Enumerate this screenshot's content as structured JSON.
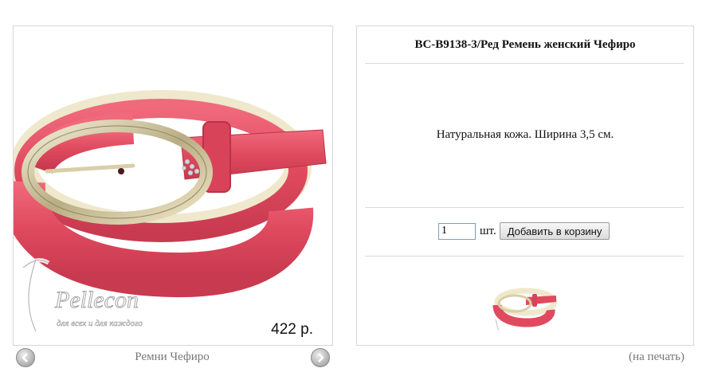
{
  "product": {
    "price": "422 р.",
    "title": "BC-B9138-3/Ред Ремень женский Чефиро",
    "description": "Натуральная кожа. Ширина 3,5 см.",
    "belt_color": "#e04a5f",
    "buckle_color": "#d8cfa8",
    "lining_color": "#efe8cc"
  },
  "watermark": {
    "brand": "Pellecon",
    "slogan": "для всех и для каждого"
  },
  "navigation": {
    "category_label": "Ремни Чефиро",
    "prev_icon": "chevron-left-icon",
    "next_icon": "chevron-right-icon",
    "print_label": "(на печать)"
  },
  "cart": {
    "quantity": "1",
    "unit_label": "шт.",
    "add_button_label": "Добавить в корзину"
  }
}
